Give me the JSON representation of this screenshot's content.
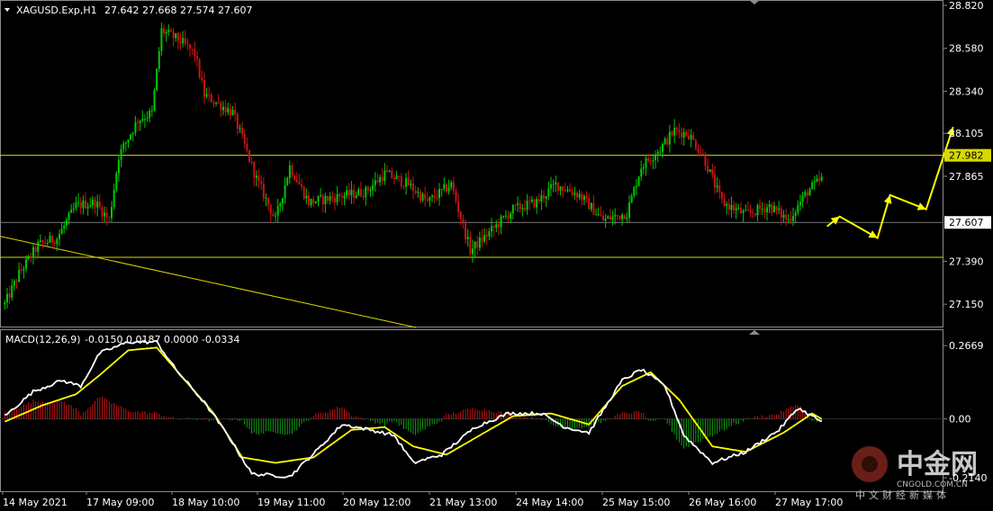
{
  "header": {
    "symbol": "XAGUSD.Exp,H1",
    "ohlc": "27.642 27.668 27.574 27.607"
  },
  "macd_header": {
    "label": "MACD(12,26,9)",
    "values": "-0.0150 0.0187 0.0000 -0.0334"
  },
  "colors": {
    "background": "#000000",
    "bull": "#00c800",
    "bear": "#c81414",
    "level_line": "#d8d800",
    "trend_line": "#d8d800",
    "arrows": "#ffff00",
    "macd_line": "#ffffff",
    "signal_line": "#ffff00",
    "hist_pos": "#c81414",
    "hist_neg": "#14a014",
    "axis_text": "#ffffff"
  },
  "watermark": {
    "name": "中金网",
    "url": "CNGOLD.COM.CN",
    "tagline": "中文财经新媒体"
  },
  "chart_data": [
    {
      "type": "candlestick",
      "title": "XAGUSD.Exp,H1",
      "ylim": [
        27.03,
        28.84
      ],
      "y_ticks": [
        "28.820",
        "28.580",
        "28.340",
        "28.105",
        "27.865",
        "27.607",
        "27.390",
        "27.150"
      ],
      "x_ticks": [
        "14 May 2021",
        "17 May 09:00",
        "18 May 10:00",
        "19 May 11:00",
        "20 May 12:00",
        "21 May 13:00",
        "24 May 14:00",
        "25 May 15:00",
        "26 May 16:00",
        "27 May 17:00"
      ],
      "current_price": "27.607",
      "horizontal_levels": [
        {
          "value": 27.982,
          "label": "27.982"
        },
        {
          "value": 27.607,
          "label": ""
        },
        {
          "value": 27.412,
          "label": ""
        }
      ],
      "trend_line": {
        "from": {
          "x": "14 May 2021",
          "y": 27.53
        },
        "to": {
          "x": "20 May 12:00",
          "y": 27.02
        }
      },
      "projection_arrows": [
        27.585,
        27.64,
        27.52,
        27.76,
        27.68,
        28.14
      ],
      "path_anchors": [
        [
          0,
          27.15
        ],
        [
          6,
          27.32
        ],
        [
          14,
          27.48
        ],
        [
          22,
          27.52
        ],
        [
          30,
          27.7
        ],
        [
          38,
          27.72
        ],
        [
          44,
          27.62
        ],
        [
          48,
          27.98
        ],
        [
          56,
          28.18
        ],
        [
          62,
          28.22
        ],
        [
          66,
          28.68
        ],
        [
          74,
          28.62
        ],
        [
          80,
          28.55
        ],
        [
          84,
          28.32
        ],
        [
          96,
          28.22
        ],
        [
          106,
          27.85
        ],
        [
          114,
          27.62
        ],
        [
          120,
          27.92
        ],
        [
          128,
          27.72
        ],
        [
          140,
          27.75
        ],
        [
          152,
          27.78
        ],
        [
          160,
          27.88
        ],
        [
          170,
          27.82
        ],
        [
          178,
          27.72
        ],
        [
          188,
          27.82
        ],
        [
          196,
          27.45
        ],
        [
          204,
          27.55
        ],
        [
          214,
          27.68
        ],
        [
          224,
          27.72
        ],
        [
          232,
          27.82
        ],
        [
          242,
          27.76
        ],
        [
          252,
          27.62
        ],
        [
          262,
          27.66
        ],
        [
          268,
          27.92
        ],
        [
          276,
          28.02
        ],
        [
          282,
          28.12
        ],
        [
          288,
          28.1
        ],
        [
          294,
          27.98
        ],
        [
          302,
          27.72
        ],
        [
          312,
          27.65
        ],
        [
          322,
          27.7
        ],
        [
          330,
          27.62
        ],
        [
          338,
          27.78
        ],
        [
          344,
          27.85
        ],
        [
          352,
          27.68
        ],
        [
          360,
          27.62
        ]
      ]
    },
    {
      "type": "macd",
      "title": "MACD(12,26,9)",
      "ylim": [
        -0.26,
        0.32
      ],
      "y_ticks": [
        "0.2669",
        "0.00",
        "-0.2140"
      ],
      "macd_anchors": [
        [
          0,
          0.01
        ],
        [
          12,
          0.1
        ],
        [
          24,
          0.14
        ],
        [
          32,
          0.12
        ],
        [
          40,
          0.24
        ],
        [
          52,
          0.28
        ],
        [
          64,
          0.28
        ],
        [
          72,
          0.18
        ],
        [
          84,
          0.06
        ],
        [
          94,
          -0.06
        ],
        [
          104,
          -0.2
        ],
        [
          120,
          -0.21
        ],
        [
          132,
          -0.11
        ],
        [
          142,
          -0.02
        ],
        [
          154,
          -0.04
        ],
        [
          164,
          -0.06
        ],
        [
          172,
          -0.16
        ],
        [
          184,
          -0.13
        ],
        [
          198,
          -0.03
        ],
        [
          212,
          0.02
        ],
        [
          226,
          0.02
        ],
        [
          236,
          -0.03
        ],
        [
          246,
          -0.05
        ],
        [
          260,
          0.14
        ],
        [
          268,
          0.18
        ],
        [
          278,
          0.12
        ],
        [
          286,
          -0.06
        ],
        [
          298,
          -0.16
        ],
        [
          312,
          -0.12
        ],
        [
          326,
          -0.04
        ],
        [
          334,
          0.04
        ],
        [
          344,
          -0.01
        ]
      ],
      "signal_anchors": [
        [
          0,
          -0.01
        ],
        [
          16,
          0.05
        ],
        [
          30,
          0.09
        ],
        [
          40,
          0.16
        ],
        [
          52,
          0.25
        ],
        [
          64,
          0.26
        ],
        [
          76,
          0.14
        ],
        [
          88,
          0.02
        ],
        [
          100,
          -0.14
        ],
        [
          114,
          -0.16
        ],
        [
          130,
          -0.14
        ],
        [
          146,
          -0.04
        ],
        [
          160,
          -0.03
        ],
        [
          172,
          -0.1
        ],
        [
          186,
          -0.13
        ],
        [
          200,
          -0.06
        ],
        [
          214,
          0.01
        ],
        [
          230,
          0.02
        ],
        [
          246,
          -0.02
        ],
        [
          260,
          0.12
        ],
        [
          272,
          0.17
        ],
        [
          284,
          0.07
        ],
        [
          298,
          -0.1
        ],
        [
          312,
          -0.12
        ],
        [
          328,
          -0.05
        ],
        [
          340,
          0.02
        ],
        [
          344,
          0.0
        ]
      ]
    }
  ]
}
